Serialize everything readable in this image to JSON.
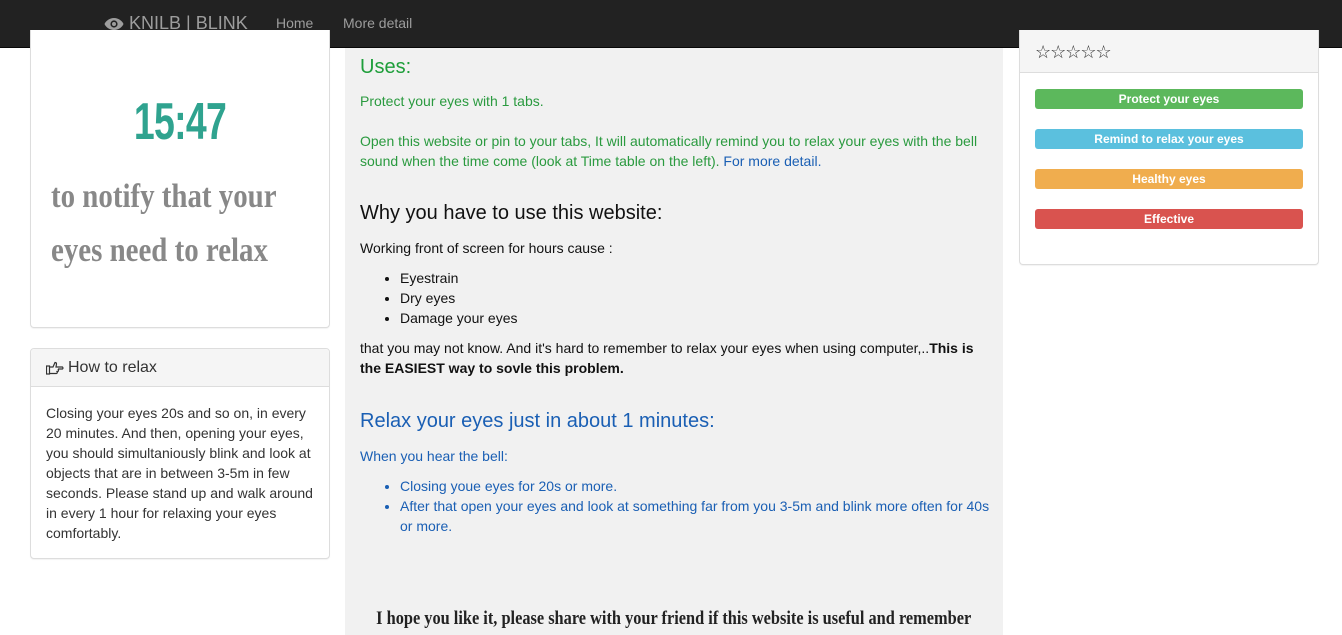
{
  "nav": {
    "brand": "KNILB | BLINK",
    "links": [
      "Home",
      "More detail"
    ]
  },
  "clock": {
    "time": "15:47",
    "message": "to notify that your eyes need to relax"
  },
  "relax_panel": {
    "title": "How to relax",
    "body": "Closing your eyes 20s and so on, in every 20 minutes. And then, opening your eyes, you should simultaniously blink and look at objects that are in between 3-5m in few seconds. Please stand up and walk around in every 1 hour for relaxing your eyes comfortably."
  },
  "main": {
    "uses_title": "Uses:",
    "uses_line1": "Protect your eyes with 1 tabs.",
    "uses_line2": "Open this website or pin to your tabs, It will automatically remind you to relax your eyes with the bell sound when the time come (look at Time table on the left).",
    "more_detail_link": "For more detail.",
    "why_title": "Why you have to use this website:",
    "why_intro": "Working front of screen for hours cause :",
    "why_items": [
      "Eyestrain",
      "Dry eyes",
      "Damage your eyes"
    ],
    "why_outro": "that you may not know. And it's hard to remember to relax your eyes when using computer,..",
    "why_bold": "This is the EASIEST way to sovle this problem.",
    "relax_title": "Relax your eyes just in about 1 minutes:",
    "relax_intro": "When you hear the bell:",
    "relax_items": [
      "Closing youe eyes for 20s or more.",
      "After that open your eyes and look at something far from you 3-5m and blink more often for 40s or more."
    ],
    "closing": "I hope you like it, please share with your friend if this website is useful and remember"
  },
  "rating": {
    "stars": "☆☆☆☆☆",
    "bars": [
      {
        "label": "Protect your eyes",
        "color": "#5cb85c"
      },
      {
        "label": "Remind to relax your eyes",
        "color": "#5bc0de"
      },
      {
        "label": "Healthy eyes",
        "color": "#f0ad4e"
      },
      {
        "label": "Effective",
        "color": "#d9534f"
      }
    ]
  },
  "icons": {
    "brand": "eye-icon",
    "relax": "hand-point-right-icon",
    "closing": "thumbs-up-icon"
  }
}
